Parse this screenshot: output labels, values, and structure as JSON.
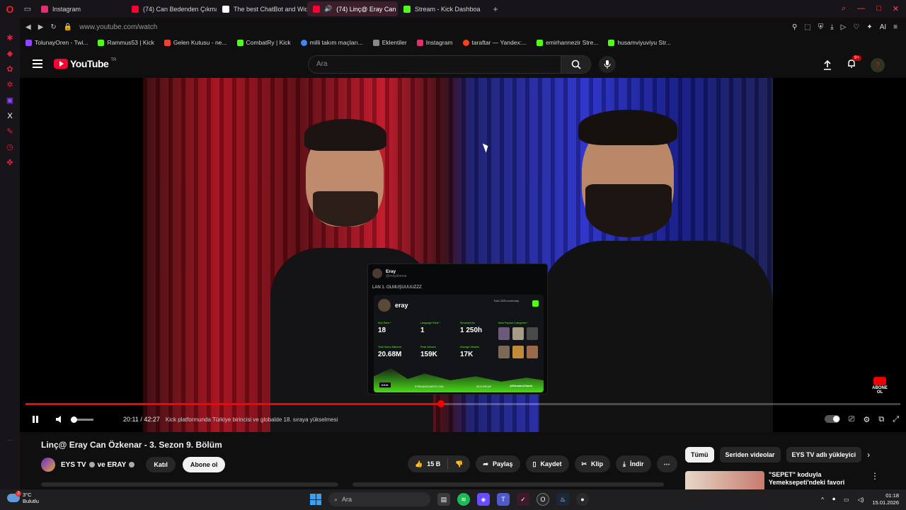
{
  "browser": {
    "tabs": [
      {
        "label": "Instagram",
        "color": "#e1306c",
        "active": false
      },
      {
        "label": "(74) Can Bedenden Çıkma",
        "color": "#ff0033",
        "active": false
      },
      {
        "label": "The best ChatBot and Wid",
        "color": "#ffffff",
        "active": false
      },
      {
        "label": "(74) Linç@ Eray Can Ö",
        "color": "#ff0033",
        "active": true
      },
      {
        "label": "Stream - Kick Dashboa",
        "color": "#53fc18",
        "active": false
      }
    ],
    "new_tab": "+",
    "url": "www.youtube.com/watch",
    "bookmarks": [
      {
        "label": "TolunayOren - Twi...",
        "color": "#9146ff"
      },
      {
        "label": "Rammus53 | Kick",
        "color": "#53fc18"
      },
      {
        "label": "Gelen Kutusu - ne...",
        "color": "#ea4335"
      },
      {
        "label": "CombatRy | Kick",
        "color": "#53fc18"
      },
      {
        "label": "milli takım maçları...",
        "color": "#4285f4"
      },
      {
        "label": "Eklentiler",
        "color": "#888888"
      },
      {
        "label": "Instagram",
        "color": "#e1306c"
      },
      {
        "label": "taraftar — Yandex:...",
        "color": "#fc3f1d"
      },
      {
        "label": "emirhannezir Stre...",
        "color": "#53fc18"
      },
      {
        "label": "husamviyuviyu Str...",
        "color": "#53fc18"
      }
    ]
  },
  "youtube": {
    "logo": "YouTube",
    "logo_region": "TR",
    "search_placeholder": "Ara",
    "notification_count": "9+",
    "player": {
      "current_time": "20:11",
      "duration": "42:27",
      "time_display": "20:11 / 42:27",
      "chapter": "Kick platformunda Türkiye birincisi ve globalde 18. sıraya yükselmesi",
      "progress": 0.475,
      "subscribe_badge": "ABONE OL"
    },
    "overlay_tweet": {
      "name": "Eray",
      "handle": "@erayzkenar",
      "text": "LAN 1. OLMUŞUUUUZZZ",
      "card": {
        "streamer": "eray",
        "summary_label": "Kick 2025 summary",
        "stats": [
          {
            "label": "Kick Rank *",
            "value": "18"
          },
          {
            "label": "Language Rank *",
            "value": "1"
          },
          {
            "label": "Streamed for",
            "value": "1 250h"
          },
          {
            "label": "Total Hours Watched",
            "value": "20.68M"
          },
          {
            "label": "Peak Viewers",
            "value": "159K"
          },
          {
            "label": "Average Viewers",
            "value": "17K"
          }
        ],
        "categories_label": "Most Popular Categories *",
        "footer_site": "STREAMSCHARTS.COM",
        "footer_kick": "KICK RECAP",
        "footer_tag": "@StreamsCharts",
        "kick_label": "KICK"
      }
    },
    "video": {
      "title": "Linç@ Eray Can Özkenar - 3. Sezon 9. Bölüm",
      "channel": "EYS TV",
      "channel_joiner": "ve ERAY",
      "join_label": "Katıl",
      "subscribe_label": "Abone ol",
      "likes": "15 B",
      "share": "Paylaş",
      "save": "Kaydet",
      "clip": "Klip",
      "download": "İndir"
    },
    "chips": [
      "Tümü",
      "Seriden videolar",
      "EYS TV adlı yükleyici"
    ],
    "rec": {
      "title": "\"SEPET\" koduyla Yemeksepeti'ndeki favori"
    }
  },
  "taskbar": {
    "temp": "3°C",
    "weather": "Bulutlu",
    "weather_badge": "2",
    "search": "Ara",
    "time": "01:18",
    "date": "15.01.2026"
  }
}
